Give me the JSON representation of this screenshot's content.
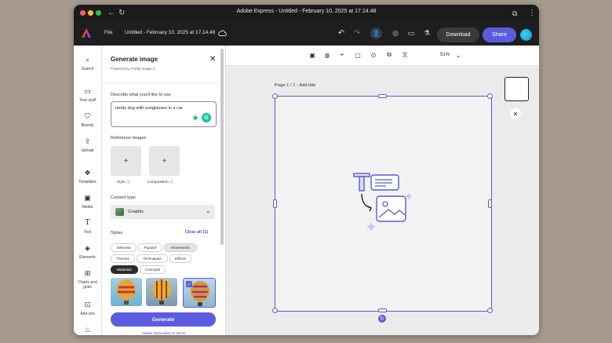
{
  "browser": {
    "window_title": "Adobe Express - Untitled - February 10, 2025 at 17.14.48",
    "controls": {
      "close": "#ff5f57",
      "minimize": "#febc2e",
      "maximize": "#28c840"
    }
  },
  "header": {
    "file_label": "File",
    "doc_title": "Untitled - February 10, 2025 at 17.14.48",
    "download_label": "Download",
    "share_label": "Share",
    "icons": [
      "adobe-express-logo",
      "cloud-icon",
      "undo-icon",
      "redo-icon",
      "person-add-icon",
      "lightbulb-icon",
      "comment-icon",
      "flask-icon"
    ]
  },
  "rail": {
    "items": [
      {
        "label": "Search",
        "icon": "search-icon"
      },
      {
        "label": "Your stuff",
        "icon": "folder-icon"
      },
      {
        "label": "Brands",
        "icon": "brand-icon"
      },
      {
        "label": "Upload",
        "icon": "upload-icon"
      },
      {
        "label": "Templates",
        "icon": "templates-icon"
      },
      {
        "label": "Media",
        "icon": "media-icon"
      },
      {
        "label": "Text",
        "icon": "text-icon"
      },
      {
        "label": "Elements",
        "icon": "elements-icon"
      },
      {
        "label": "Charts and grids",
        "icon": "charts-icon"
      },
      {
        "label": "Add-ons",
        "icon": "addons-icon"
      }
    ]
  },
  "panel": {
    "title": "Generate image",
    "subtitle": "Powered by Firefly Image 3",
    "prompt_label": "Describe what you'd like to see",
    "prompt_value": "nerdy dog with sunglasses in a car",
    "reference_label": "Reference images",
    "ref_style_label": "Style",
    "ref_composition_label": "Composition",
    "content_type_label": "Content type",
    "content_type_value": "Graphic",
    "styles_label": "Styles",
    "clear_all_label": "Clear all (1)",
    "chips_row1": [
      "Selected",
      "Popular",
      "Movements"
    ],
    "chips_row2": [
      "Themes",
      "Techniques",
      "Effects"
    ],
    "chips_row3": [
      "Materials",
      "Concepts"
    ],
    "active_chip": "Materials",
    "generate_label": "Generate",
    "terms_label": "Adobe Generative AI terms"
  },
  "toolbar": {
    "zoom": "51%"
  },
  "canvas": {
    "page_label": "Page 1 / 1 - Add title",
    "accent": "#5a5ad8"
  }
}
